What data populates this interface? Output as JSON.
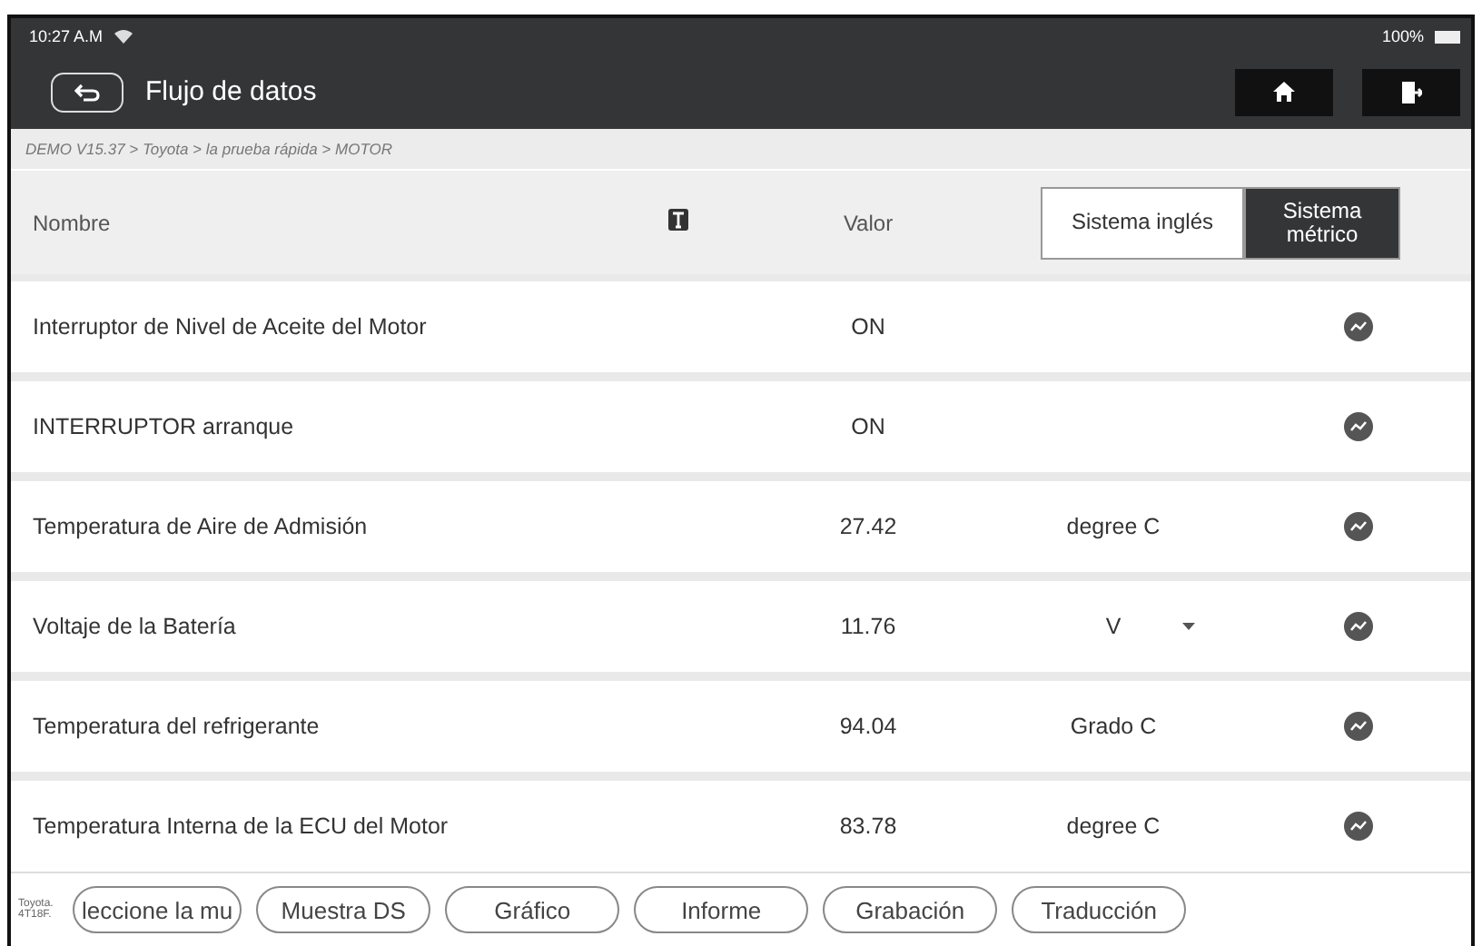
{
  "status_bar": {
    "time": "10:27 A.M",
    "battery": "100%"
  },
  "header": {
    "title": "Flujo de datos"
  },
  "breadcrumb": "DEMO V15.37 > Toyota > la prueba rápida > MOTOR",
  "table": {
    "columns": [
      "Nombre",
      "Valor"
    ],
    "unit_toggle": [
      {
        "label": "Sistema inglés",
        "selected": false
      },
      {
        "label": "Sistema métrico",
        "selected": true
      }
    ],
    "rows": [
      {
        "name": "Interruptor de Nivel de Aceite del Motor",
        "value": "ON",
        "unit": "",
        "dropdown": false
      },
      {
        "name": "INTERRUPTOR arranque",
        "value": "ON",
        "unit": "",
        "dropdown": false
      },
      {
        "name": "Temperatura de Aire de Admisión",
        "value": "27.42",
        "unit": "degree C",
        "dropdown": false
      },
      {
        "name": "Voltaje de la Batería",
        "value": "11.76",
        "unit": "V",
        "dropdown": true
      },
      {
        "name": "Temperatura del refrigerante",
        "value": "94.04",
        "unit": "Grado C",
        "dropdown": false
      },
      {
        "name": "Temperatura Interna de la ECU del Motor",
        "value": "83.78",
        "unit": "degree C",
        "dropdown": false
      }
    ]
  },
  "footer": {
    "vehicle": [
      "Toyota.",
      "4T18F."
    ],
    "buttons": [
      "leccione la mu",
      "Muestra DS",
      "Gráfico",
      "Informe",
      "Grabación",
      "Traducción"
    ]
  }
}
